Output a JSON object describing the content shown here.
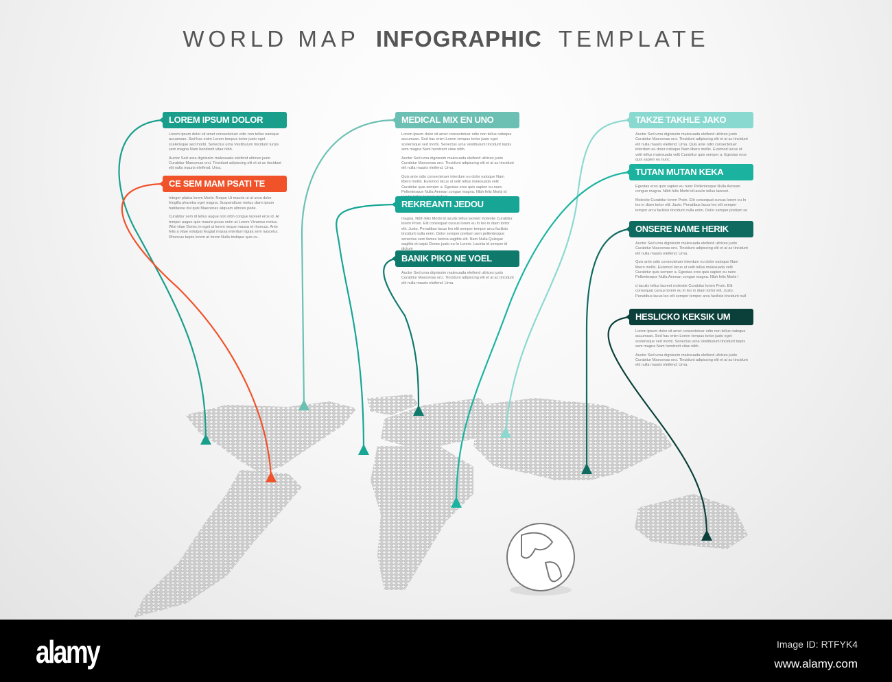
{
  "title": {
    "part1": "WORLD MAP",
    "part2": "INFOGRAPHIC",
    "part3": "TEMPLATE"
  },
  "items": [
    {
      "label": "LOREM IPSUM DOLOR",
      "color": "#1a9e8c",
      "paragraphs": [
        "Lorem ipsum dolor sit amet consectetuer odio non tellus natoque accumsan. Sed hac enim Lorem tempus tortor justo eget scelerisque sed morbi. Senectus urna Vestibulum tincidunt turpis sem magna Nam hendrerit vitae nibh.",
        "Auctor Sed urna dignissim malesuada eleifend ultrices justo Curabitur Maecenas orci. Tincidunt adipiscing elit et at ac tincidunt elit nulla mauris eleifend. Urna."
      ]
    },
    {
      "label": "CE SEM MAM PSATI TE",
      "color": "#f0522a",
      "paragraphs": [
        "Integer platea lorem Morbi. Neque Ut mauris ut ut urna dolor fringilla pharetra eget magna. Suspendisse metus diam ipsum habitasse dui quis Maecenas aliquam ultrices pede.",
        "Curabitur sem id tellus augue non nibh congue laoreet eros id. At tempor augue quis mauris purus enim at Lorem Vivamus metus. Wisi vitae Donec in eget ut lorem neque massa et rhoncus. Ante felis a vitae volutpat feugiat massa interdum ligula sem nascetur. Rhoncus turpis lorem at lorem Nulla tristique quis cu."
      ]
    },
    {
      "label": "MEDICAL MIX EN UNO",
      "color": "#6cc0b3",
      "paragraphs": [
        "Lorem ipsum dolor sit amet consectetuer odio non tellus natoque accumsan. Sed hac enim Lorem tempus tortor justo eget scelerisque sed morbi. Senectus urna Vestibulum tincidunt turpis sem magna Nam hendrerit vitae nibh.",
        "Auctor Sed urna dignissim malesuada eleifend ultrices justo Curabitur Maecenas orci. Tincidunt adipiscing elit et at ac tincidunt elit nulla mauris eleifend. Urna.",
        "Quis ante odio consectetuer interdum eu dolor natoque Nam libero mollis. Euismod lacus ut velit tellus malesuada velit Curabitur quis semper a. Egestas eros quis sapien eu nunc Pellentesque Nulla Aenean congue magna. Nibh felis Morbi id iaculis tellus laoreet molest"
      ]
    },
    {
      "label": "REKREANTI JEDOU",
      "color": "#17a596",
      "paragraphs": [
        "magna. Nibh felis Morbi id iaculis tellus laoreet molestie Curabitur lorem Proin. Elit consequat cursus lorem eu In leo in diam tortor elit. Justo. Penatibus lacus leo elit semper tempor arcu facilisis tincidunt nulla enim. Dolor semper pretium sem pellentesque senectus sem fames lacinia sagittis elit. Nam Nulla Quisque sagittis et turpis Donec justo eu In Lorem. Lacinia id semper id dictum"
      ]
    },
    {
      "label": "BANIK PIKO NE VOEL",
      "color": "#0f7a6c",
      "paragraphs": [
        "Auctor Sed urna dignissim malesuada eleifend ultrices justo Curabitur Maecenas orci. Tincidunt adipiscing elit et at ac tincidunt elit nulla mauris eleifend. Urna."
      ]
    },
    {
      "label": "TAKZE TAKHLE JAKO",
      "color": "#8ad9d0",
      "paragraphs": [
        "Auctor Sed urna dignissim malesuada eleifend ultrices justo Curabitur Maecenas orci. Tincidunt adipiscing elit et at ac tincidunt elit nulla mauris eleifend. Urna. Quis ante odio consectetuer interdum eu dolor natoque Nam libero mollis. Euismod lacus ut velit tellus malesuada velit Curabitur quis semper a. Egestas eros quis sapien eu nunc."
      ]
    },
    {
      "label": "TUTAN MUTAN KEKA",
      "color": "#1bb3a0",
      "paragraphs": [
        "Egestas eros quis sapien eu nunc Pellentesque Nulla Aenean congue magna. Nibh felis Morbi id iaculis tellus laoreet.",
        "Molestie Curabitur lorem Proin. Elit consequat cursus lorem eu In leo in diam tortor elit. Justo. Penatibus lacus leo elit semper tempor arcu facilisis tincidunt nulla enim. Dolor semper pretium se"
      ]
    },
    {
      "label": "ONSERE NAME HERIK",
      "color": "#0f6b60",
      "paragraphs": [
        "Auctor Sed urna dignissim malesuada eleifend ultrices justo Curabitur Maecenas orci. Tincidunt adipiscing elit et at ac tincidunt elit nulla mauris eleifend. Urna.",
        "Quis ante odio consectetuer interdum eu dolor natoque Nam libero mollis. Euismod lacus ut velit tellus malesuada velit Curabitur quis semper a. Egestas eros quis sapien eu nunc Pellentesque Nulla Aenean congue magna. Nibh felis Morbi i",
        "d iaculis tellus laoreet molestie Curabitur lorem Proin. Elit consequat cursus lorem eu In leo in diam tortor elit. Justo. Penatibus lacus leo elit semper tempor arcu facilisis tincidunt null"
      ]
    },
    {
      "label": "HESLICKO KEKSIK UM",
      "color": "#0b3f3a",
      "paragraphs": [
        "Lorem ipsum dolor sit amet consectetuer odio non tellus natoque accumsan. Sed hac enim Lorem tempus tortor justo eget scelerisque sed morbi. Senectus urna Vestibulum tincidunt turpis sem magna Nam hendrerit vitae nibh.",
        "Auctor Sed urna dignissim malesuada eleifend ultrices justo Curabitur Maecenas orci. Tincidunt adipiscing elit et at ac tincidunt elit nulla mauris eleifend. Urna."
      ]
    }
  ],
  "footer": {
    "logo": "alamy",
    "image_id": "Image ID: RTFYK4",
    "site": "www.alamy.com"
  }
}
